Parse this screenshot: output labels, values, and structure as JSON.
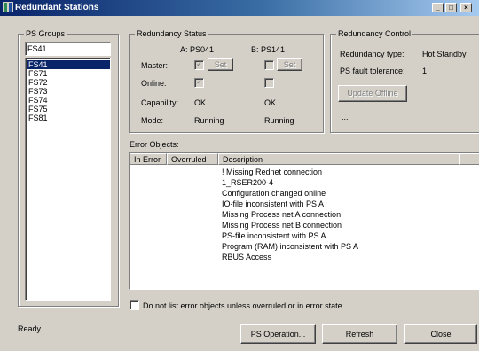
{
  "window": {
    "title": "Redundant Stations",
    "min": "_",
    "max": "□",
    "close": "×"
  },
  "ps_groups": {
    "legend": "PS Groups",
    "filter_value": "FS41",
    "items": [
      "FS41",
      "FS71",
      "FS72",
      "FS73",
      "FS74",
      "FS75",
      "FS81"
    ],
    "selected": "FS41"
  },
  "status": {
    "legend": "Redundancy Status",
    "col_a": "A: PS041",
    "col_b": "B: PS141",
    "master_label": "Master:",
    "online_label": "Online:",
    "capability_label": "Capability:",
    "mode_label": "Mode:",
    "set_label": "Set",
    "cap_a": "OK",
    "cap_b": "OK",
    "mode_a": "Running",
    "mode_b": "Running",
    "master_a_checked": true,
    "master_b_checked": false,
    "online_a_checked": true,
    "online_b_checked": false
  },
  "control": {
    "legend": "Redundancy Control",
    "type_label": "Redundancy type:",
    "type_value": "Hot Standby",
    "fault_label": "PS fault tolerance:",
    "fault_value": "1",
    "update_label": "Update Offline",
    "ellipsis": "..."
  },
  "errors": {
    "label": "Error Objects:",
    "columns": [
      "In Error",
      "Overruled",
      "Description"
    ],
    "rows": [
      "! Missing Rednet connection",
      "1_RSER200-4",
      "Configuration changed online",
      "IO-file inconsistent with PS A",
      "Missing Process net A connection",
      "Missing Process net B connection",
      "PS-file inconsistent with PS A",
      "Program (RAM) inconsistent with PS A",
      "RBUS Access"
    ],
    "filter_checkbox_label": "Do not list error objects unless overruled or in error state"
  },
  "footer": {
    "status": "Ready",
    "ps_operation": "PS Operation...",
    "refresh": "Refresh",
    "close": "Close"
  }
}
